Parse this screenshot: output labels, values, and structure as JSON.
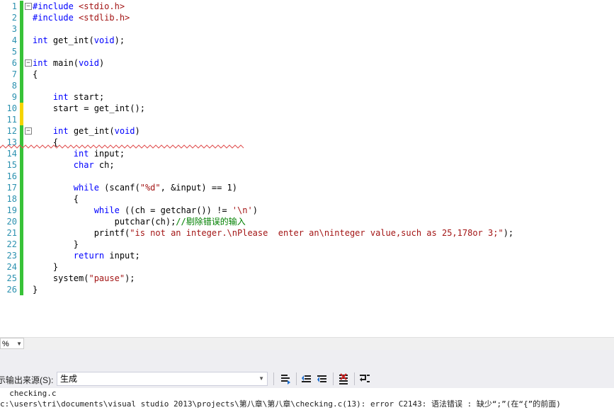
{
  "editor": {
    "lines": [
      {
        "n": "1",
        "mark": "green",
        "fold": "−",
        "segs": [
          {
            "t": "#include ",
            "c": "pp"
          },
          {
            "t": "<stdio.h>",
            "c": "str"
          }
        ]
      },
      {
        "n": "2",
        "mark": "green",
        "fold": "",
        "segs": [
          {
            "t": "#include ",
            "c": "pp"
          },
          {
            "t": "<stdlib.h>",
            "c": "str"
          }
        ]
      },
      {
        "n": "3",
        "mark": "green",
        "fold": "",
        "segs": []
      },
      {
        "n": "4",
        "mark": "green",
        "fold": "",
        "segs": [
          {
            "t": "int",
            "c": "kw"
          },
          {
            "t": " get_int(",
            "c": ""
          },
          {
            "t": "void",
            "c": "kw"
          },
          {
            "t": ");",
            "c": ""
          }
        ]
      },
      {
        "n": "5",
        "mark": "green",
        "fold": "",
        "segs": []
      },
      {
        "n": "6",
        "mark": "green",
        "fold": "−",
        "segs": [
          {
            "t": "int",
            "c": "kw"
          },
          {
            "t": " main(",
            "c": ""
          },
          {
            "t": "void",
            "c": "kw"
          },
          {
            "t": ")",
            "c": ""
          }
        ]
      },
      {
        "n": "7",
        "mark": "green",
        "fold": "",
        "segs": [
          {
            "t": "{",
            "c": ""
          }
        ]
      },
      {
        "n": "8",
        "mark": "green",
        "fold": "",
        "segs": []
      },
      {
        "n": "9",
        "mark": "green",
        "fold": "",
        "segs": [
          {
            "t": "    ",
            "c": ""
          },
          {
            "t": "int",
            "c": "kw"
          },
          {
            "t": " start;",
            "c": ""
          }
        ]
      },
      {
        "n": "10",
        "mark": "yellow",
        "fold": "",
        "segs": [
          {
            "t": "    start = get_int();",
            "c": ""
          }
        ]
      },
      {
        "n": "11",
        "mark": "yellow",
        "fold": "",
        "segs": []
      },
      {
        "n": "12",
        "mark": "green",
        "fold": "−",
        "segs": [
          {
            "t": "    ",
            "c": ""
          },
          {
            "t": "int",
            "c": "kw"
          },
          {
            "t": " get_int(",
            "c": ""
          },
          {
            "t": "void",
            "c": "kw"
          },
          {
            "t": ")",
            "c": ""
          }
        ]
      },
      {
        "n": "13",
        "mark": "green",
        "fold": "",
        "segs": [
          {
            "t": "    {",
            "c": ""
          }
        ]
      },
      {
        "n": "14",
        "mark": "green",
        "fold": "",
        "segs": [
          {
            "t": "        ",
            "c": ""
          },
          {
            "t": "int",
            "c": "kw"
          },
          {
            "t": " input;",
            "c": ""
          }
        ]
      },
      {
        "n": "15",
        "mark": "green",
        "fold": "",
        "segs": [
          {
            "t": "        ",
            "c": ""
          },
          {
            "t": "char",
            "c": "kw"
          },
          {
            "t": " ch;",
            "c": ""
          }
        ]
      },
      {
        "n": "16",
        "mark": "green",
        "fold": "",
        "segs": []
      },
      {
        "n": "17",
        "mark": "green",
        "fold": "",
        "segs": [
          {
            "t": "        ",
            "c": ""
          },
          {
            "t": "while",
            "c": "kw"
          },
          {
            "t": " (scanf(",
            "c": ""
          },
          {
            "t": "\"%d\"",
            "c": "str"
          },
          {
            "t": ", &input) == 1)",
            "c": ""
          }
        ]
      },
      {
        "n": "18",
        "mark": "green",
        "fold": "",
        "segs": [
          {
            "t": "        {",
            "c": ""
          }
        ]
      },
      {
        "n": "19",
        "mark": "green",
        "fold": "",
        "segs": [
          {
            "t": "            ",
            "c": ""
          },
          {
            "t": "while",
            "c": "kw"
          },
          {
            "t": " ((ch = getchar()) != ",
            "c": ""
          },
          {
            "t": "'\\n'",
            "c": "str"
          },
          {
            "t": ")",
            "c": ""
          }
        ]
      },
      {
        "n": "20",
        "mark": "green",
        "fold": "",
        "segs": [
          {
            "t": "                putchar(ch);",
            "c": ""
          },
          {
            "t": "//剔除错误的输入",
            "c": "cmt"
          }
        ]
      },
      {
        "n": "21",
        "mark": "green",
        "fold": "",
        "segs": [
          {
            "t": "            printf(",
            "c": ""
          },
          {
            "t": "\"is not an integer.\\nPlease  enter an\\ninteger value,such as 25,178or 3;\"",
            "c": "str"
          },
          {
            "t": ");",
            "c": ""
          }
        ]
      },
      {
        "n": "22",
        "mark": "green",
        "fold": "",
        "segs": [
          {
            "t": "        }",
            "c": ""
          }
        ]
      },
      {
        "n": "23",
        "mark": "green",
        "fold": "",
        "segs": [
          {
            "t": "        ",
            "c": ""
          },
          {
            "t": "return",
            "c": "kw"
          },
          {
            "t": " input;",
            "c": ""
          }
        ]
      },
      {
        "n": "24",
        "mark": "green",
        "fold": "",
        "segs": [
          {
            "t": "    }",
            "c": ""
          }
        ]
      },
      {
        "n": "25",
        "mark": "green",
        "fold": "",
        "segs": [
          {
            "t": "    system(",
            "c": ""
          },
          {
            "t": "\"pause\"",
            "c": "str"
          },
          {
            "t": ");",
            "c": ""
          }
        ]
      },
      {
        "n": "26",
        "mark": "green",
        "fold": "",
        "segs": [
          {
            "t": "}",
            "c": ""
          }
        ]
      }
    ]
  },
  "colors": {
    "green_mark": "#38c238",
    "yellow_mark": "#f5d400",
    "squiggle": "#e05050",
    "keyword": "#0000ff",
    "string": "#a31515",
    "comment": "#008000",
    "line_number": "#2b91af"
  },
  "statusbar": {
    "zoom": "%"
  },
  "output": {
    "source_label": "示输出来源(S):",
    "source_value": "生成",
    "toolbar_icons": [
      "goto-location-icon",
      "previous-message-icon",
      "next-message-icon",
      "clear-all-icon",
      "toggle-word-wrap-icon"
    ],
    "lines": [
      "  checking.c",
      "c:\\users\\tri\\documents\\visual studio 2013\\projects\\第八章\\第八章\\checking.c(13): error C2143: 语法错误 : 缺少“;”(在“{”的前面)"
    ]
  }
}
